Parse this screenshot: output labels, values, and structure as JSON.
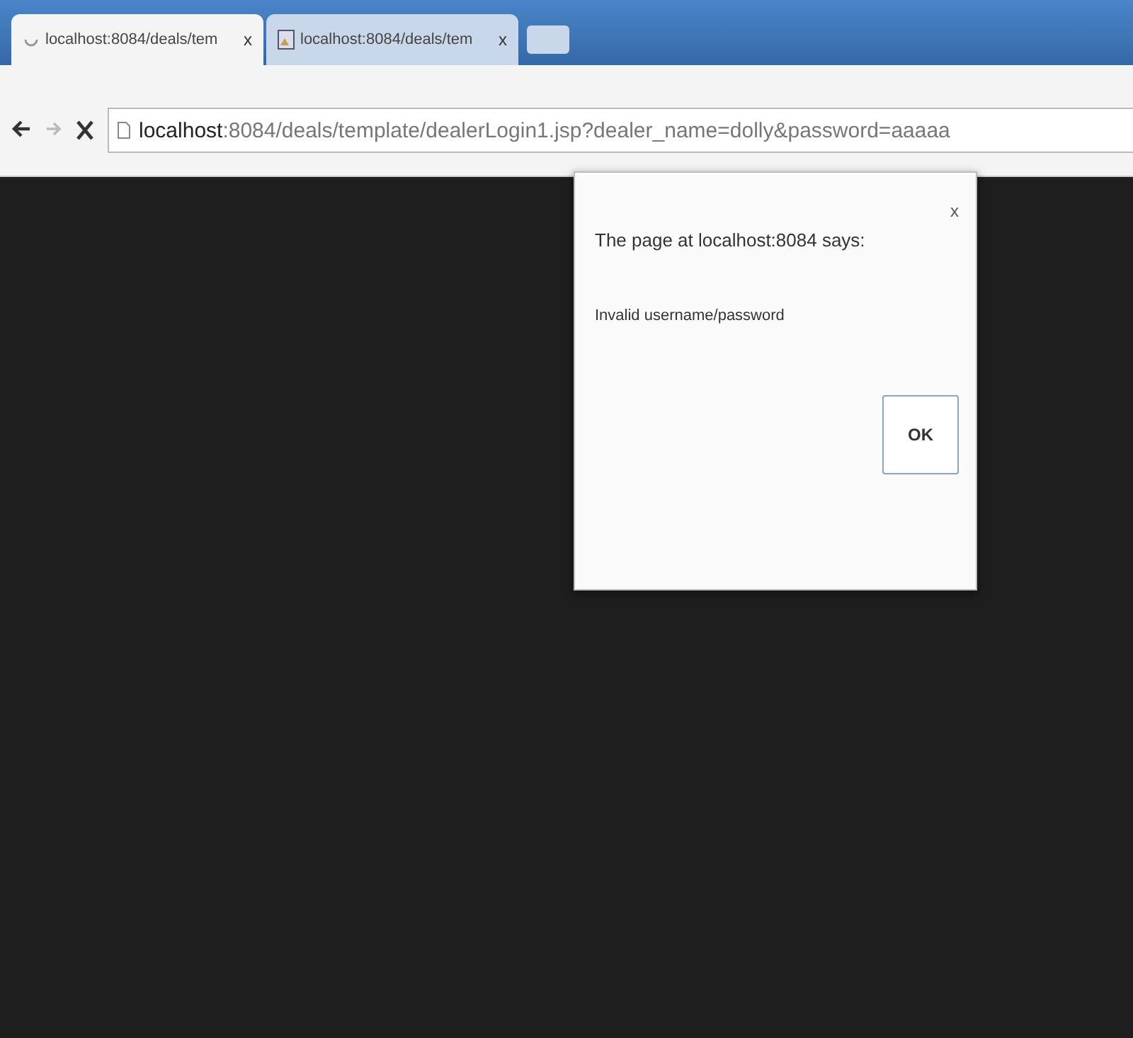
{
  "tabs": [
    {
      "title": "localhost:8084/deals/tem",
      "close": "x",
      "selected": true,
      "kind": "loading"
    },
    {
      "title": "localhost:8084/deals/tem",
      "close": "x",
      "selected": false,
      "kind": "image"
    }
  ],
  "toolbar": {
    "back_enabled": true,
    "forward_enabled": false
  },
  "address_bar": {
    "host": "localhost",
    "rest": ":8084/deals/template/dealerLogin1.jsp?dealer_name=dolly&password=aaaaa"
  },
  "dialog": {
    "title": "The page at localhost:8084 says:",
    "close": "x",
    "message": "Invalid username/password",
    "button": "OK"
  }
}
